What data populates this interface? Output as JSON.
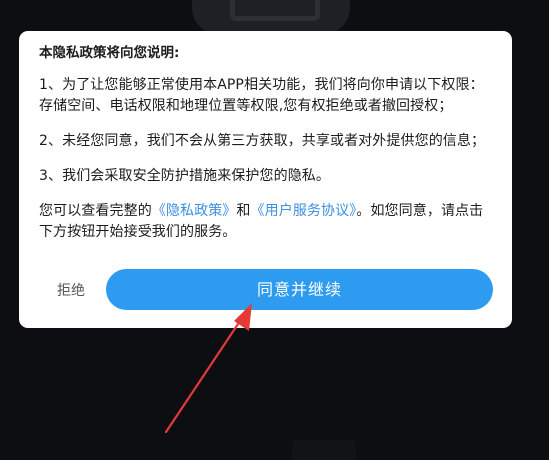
{
  "dialog": {
    "title": "本隐私政策将向您说明:",
    "items": [
      "1、为了让您能够正常使用本APP相关功能，我们将向你申请以下权限：存储空间、电话权限和地理位置等权限,您有权拒绝或者撤回授权；",
      "2、未经您同意，我们不会从第三方获取，共享或者对外提供您的信息；",
      "3、我们会采取安全防护措施来保护您的隐私。"
    ],
    "notice": {
      "prefix": "您可以查看完整的",
      "privacy_link": "《隐私政策》",
      "and": "和",
      "terms_link": "《用户服务协议》",
      "suffix": "。如您同意，请点击下方按钮开始接受我们的服务。"
    },
    "reject_label": "拒绝",
    "agree_label": "同意并继续"
  },
  "colors": {
    "accent": "#2d9cf0",
    "link": "#3d8fe0",
    "arrow": "#e53935",
    "overlay": "#0c0e11"
  }
}
